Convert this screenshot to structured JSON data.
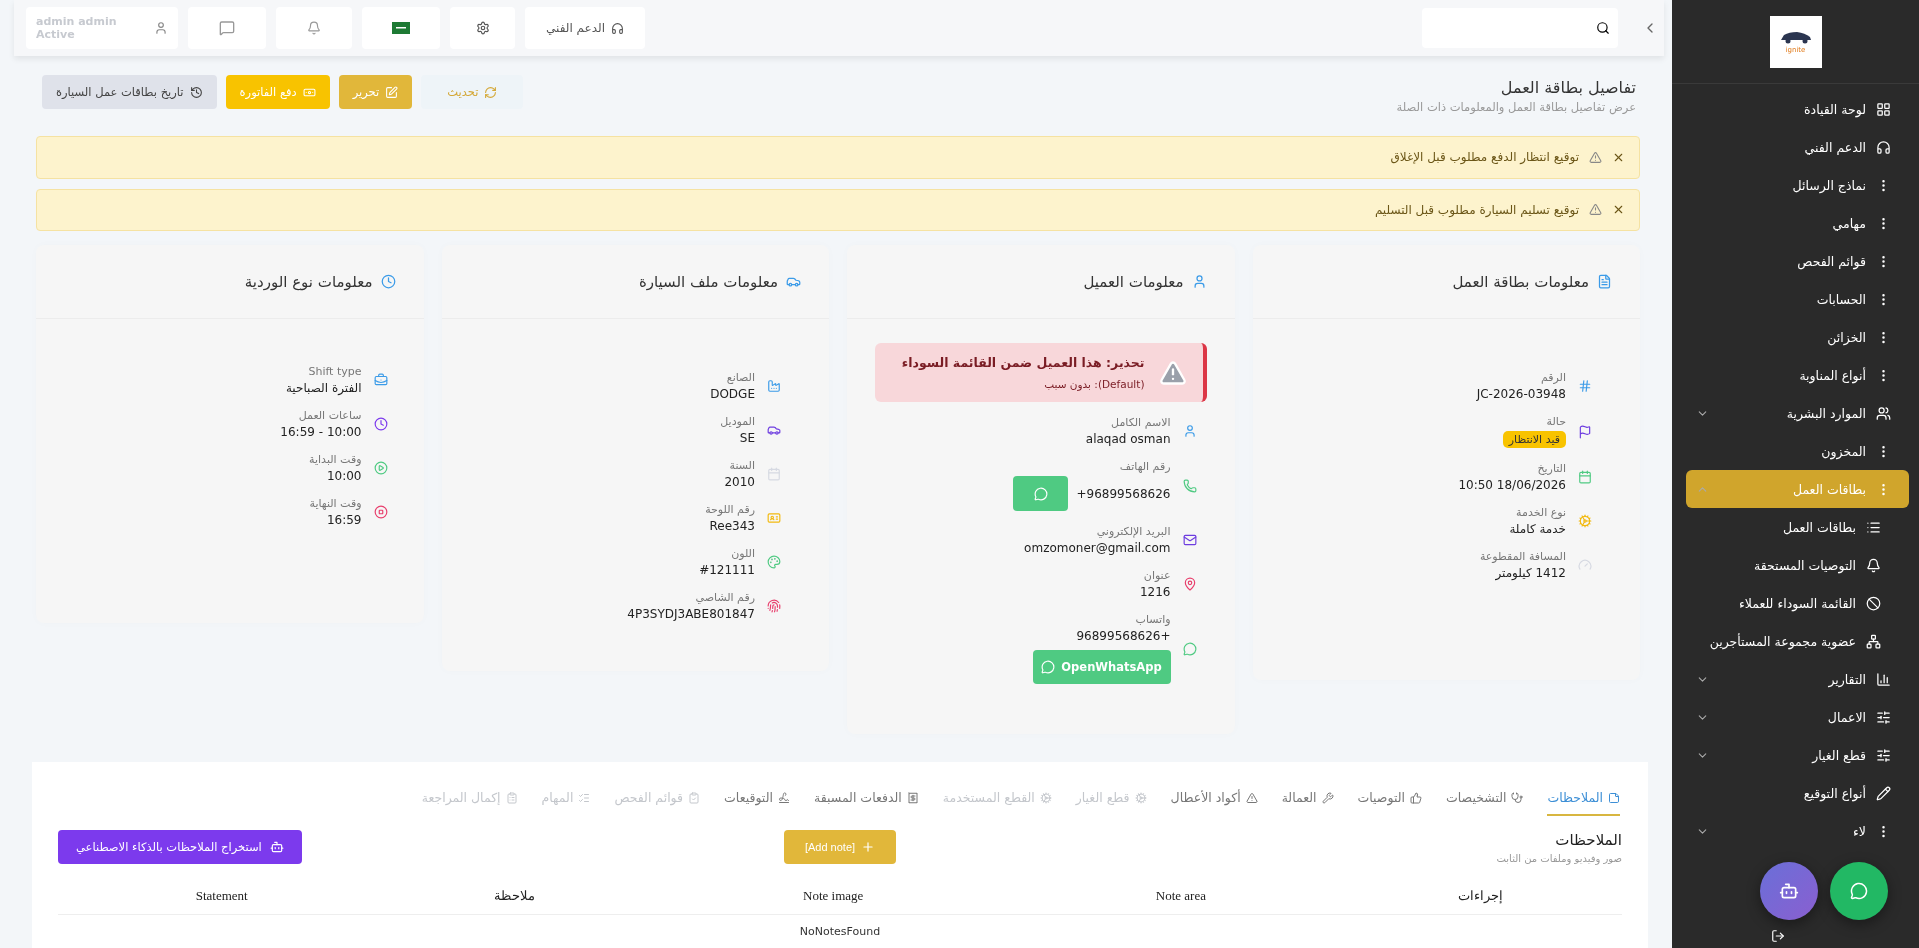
{
  "sidebar": {
    "logo": {
      "text": "ignite"
    },
    "items": [
      {
        "label": "لوحة القيادة",
        "selected": false
      },
      {
        "label": "الدعم الفني",
        "selected": false
      },
      {
        "label": "نماذج الرسائل",
        "selected": false
      },
      {
        "label": "مهامي",
        "selected": false
      },
      {
        "label": "قوائم الفحص",
        "selected": false
      },
      {
        "label": "الحسابات",
        "selected": false
      },
      {
        "label": "الخزائن",
        "selected": false
      },
      {
        "label": "أنواع المناوبة",
        "selected": false
      },
      {
        "label": "الموارد البشرية",
        "selected": false,
        "expanded": false
      },
      {
        "label": "المخزون",
        "selected": false
      },
      {
        "label": "بطاقات العمل",
        "selected": true,
        "expanded": true,
        "children": [
          {
            "label": "بطاقات العمل",
            "selected": false
          },
          {
            "label": "التوصيات المستحقة",
            "selected": false
          },
          {
            "label": "القائمة السوداء للعملاء",
            "selected": false
          },
          {
            "label": "عضوية مجموعة المستأجرين",
            "selected": false
          }
        ]
      },
      {
        "label": "التقارير",
        "selected": false,
        "expanded": false
      },
      {
        "label": "الاعمال",
        "selected": false,
        "expanded": false
      },
      {
        "label": "قطع الغيار",
        "selected": false,
        "expanded": false
      },
      {
        "label": "أنواع التوقيع",
        "selected": false
      },
      {
        "label": "لاء",
        "selected": false,
        "expanded": false
      }
    ]
  },
  "topbar": {
    "support": "الدعم الفني",
    "user": {
      "name": "admin admin",
      "status": "Active"
    }
  },
  "header": {
    "title": "تفاصيل بطاقة العمل",
    "subtitle": "عرض تفاصيل بطاقة العمل والمعلومات ذات الصلة",
    "buttons": [
      {
        "label": "تحديث",
        "kind": "light"
      },
      {
        "label": "تحرير",
        "kind": "gold"
      },
      {
        "label": "دفع الفاتورة",
        "kind": "yellow"
      },
      {
        "label": "تاريخ بطاقات عمل السيارة",
        "kind": "grey"
      }
    ]
  },
  "alerts": [
    "توقيع انتظار الدفع مطلوب قبل الإغلاق",
    "توقيع تسليم السيارة مطلوب قبل التسليم"
  ],
  "cards": [
    {
      "title": "معلومات بطاقة العمل",
      "fields": [
        {
          "label": "الرقم",
          "value": "JC-2026-03948",
          "kind": "text"
        },
        {
          "label": "حالة",
          "value": "قيد الانتظار",
          "kind": "badge"
        },
        {
          "label": "التاريخ",
          "value": "18/06/2026 10:50",
          "kind": "text"
        },
        {
          "label": "نوع الخدمة",
          "value": "خدمة كاملة",
          "kind": "text"
        },
        {
          "label": "المسافة المقطوعة",
          "value": "1412 كيلومتر",
          "kind": "text"
        }
      ]
    },
    {
      "title": "معلومات العميل",
      "warning": {
        "title": "تحذير: هذا العميل ضمن القائمة السوداء",
        "reason": "(Default): بدون سبب"
      },
      "fields": [
        {
          "label": "الاسم الكامل",
          "value": "alaqad osman",
          "kind": "text"
        },
        {
          "label": "رقم الهاتف",
          "value": "+96899568626",
          "kind": "phone"
        },
        {
          "label": "البريد الإلكتروني",
          "value": "omzomoner@gmail.com",
          "kind": "text"
        },
        {
          "label": "عنوان",
          "value": "1216",
          "kind": "text"
        },
        {
          "label": "واتساب",
          "value": "+96899568626",
          "kind": "whatsapp",
          "button": "OpenWhatsApp"
        }
      ]
    },
    {
      "title": "معلومات ملف السيارة",
      "fields": [
        {
          "label": "الصانع",
          "value": "DODGE",
          "kind": "text"
        },
        {
          "label": "الموديل",
          "value": "SE",
          "kind": "text"
        },
        {
          "label": "السنة",
          "value": "2010",
          "kind": "text"
        },
        {
          "label": "رقم اللوحة",
          "value": "Ree343",
          "kind": "text"
        },
        {
          "label": "اللون",
          "value": "#121111",
          "kind": "text"
        },
        {
          "label": "رقم الشاصي",
          "value": "4P3SYDJ3ABE801847",
          "kind": "text"
        }
      ]
    },
    {
      "title": "معلومات نوع الوردية",
      "fields": [
        {
          "label": "Shift type",
          "value": "الفترة الصباحية",
          "kind": "text"
        },
        {
          "label": "ساعات العمل",
          "value": "10:00 - 16:59",
          "kind": "text"
        },
        {
          "label": "وقت البداية",
          "value": "10:00",
          "kind": "text"
        },
        {
          "label": "وقت النهاية",
          "value": "16:59",
          "kind": "text"
        }
      ]
    }
  ],
  "tabs": [
    {
      "label": "الملاحظات",
      "selected": true,
      "disabled": false
    },
    {
      "label": "التشخيصات",
      "selected": false,
      "disabled": false
    },
    {
      "label": "التوصيات",
      "selected": false,
      "disabled": false
    },
    {
      "label": "العمالة",
      "selected": false,
      "disabled": false
    },
    {
      "label": "أكواد الأعطال",
      "selected": false,
      "disabled": false
    },
    {
      "label": "قطع الغيار",
      "selected": false,
      "disabled": true
    },
    {
      "label": "القطع المستخدمة",
      "selected": false,
      "disabled": true
    },
    {
      "label": "الدفعات المسبقة",
      "selected": false,
      "disabled": false
    },
    {
      "label": "التوقيعات",
      "selected": false,
      "disabled": false
    },
    {
      "label": "قوائم الفحص",
      "selected": false,
      "disabled": true
    },
    {
      "label": "المهام",
      "selected": false,
      "disabled": true
    },
    {
      "label": "إكمال المراجعة",
      "selected": false,
      "disabled": true
    }
  ],
  "notes": {
    "title": "الملاحظات",
    "subtitle": "صور وفيديو وملفات من الثابت",
    "add_button": "[Add note]",
    "ai_button": "استخراج الملاحظات بالذكاء الاصطناعي",
    "columns": [
      "إجراءات",
      "Note area",
      "Note image",
      "ملاحظة",
      "Statement"
    ],
    "empty": "NoNotesFound"
  }
}
